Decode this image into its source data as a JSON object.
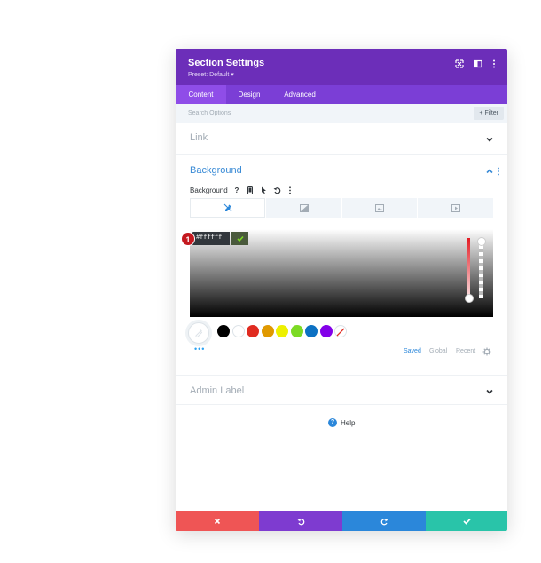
{
  "header": {
    "title": "Section Settings",
    "preset": "Preset: Default ▾",
    "icons": [
      "expand-icon",
      "sidebar-icon",
      "more-icon"
    ]
  },
  "tabs": [
    {
      "label": "Content",
      "active": true
    },
    {
      "label": "Design",
      "active": false
    },
    {
      "label": "Advanced",
      "active": false
    }
  ],
  "search": {
    "placeholder": "Search Options",
    "filter_label": "+ Filter"
  },
  "link_section": {
    "title": "Link"
  },
  "background_section": {
    "title": "Background",
    "field_label": "Background",
    "options": [
      "help-icon",
      "mobile-icon",
      "pointer-icon",
      "reset-icon",
      "more-icon"
    ],
    "bg_tabs": [
      "color-icon",
      "gradient-icon",
      "image-icon",
      "video-icon"
    ],
    "hex_value": "#ffffff",
    "badge": "1",
    "swatches": [
      "#000000",
      "#ffffff",
      "#e02b20",
      "#e09900",
      "#edf000",
      "#7cda24",
      "#0c71c3",
      "#8300e9"
    ],
    "more": "•••",
    "palette_tabs": {
      "saved": "Saved",
      "global": "Global",
      "recent": "Recent"
    }
  },
  "admin_section": {
    "title": "Admin Label"
  },
  "help": {
    "label": "Help"
  },
  "footer": {
    "buttons": [
      {
        "name": "cancel",
        "color": "#ef5555"
      },
      {
        "name": "undo",
        "color": "#7e3bd0"
      },
      {
        "name": "redo",
        "color": "#2b87da"
      },
      {
        "name": "save",
        "color": "#29c4a9"
      }
    ]
  },
  "colors": {
    "header": "#6c2eb9",
    "tabs": "#7b3ed6",
    "accent_blue": "#2b87da",
    "section_title": "#3a8bd6",
    "muted_title": "#a3acb5"
  }
}
